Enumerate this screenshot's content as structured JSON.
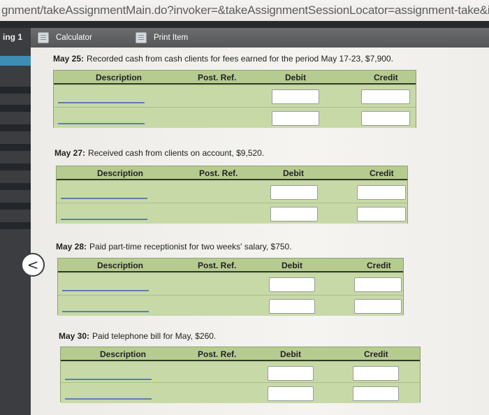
{
  "browser": {
    "url": "gnment/takeAssignmentMain.do?invoker=&takeAssignmentSessionLocator=assignment-take&inprogress"
  },
  "sidebar": {
    "tab_label": "ing 1"
  },
  "toolbar": {
    "calculator_label": "Calculator",
    "print_label": "Print Item"
  },
  "columns": {
    "description": "Description",
    "post_ref": "Post. Ref.",
    "debit": "Debit",
    "credit": "Credit"
  },
  "nav": {
    "back_symbol": "<"
  },
  "transactions": [
    {
      "date": "May 25:",
      "text": "Recorded cash from cash clients for fees earned for the period May 17-23, $7,900."
    },
    {
      "date": "May 27:",
      "text": "Received cash from clients on account, $9,520."
    },
    {
      "date": "May 28:",
      "text": "Paid part-time receptionist for two weeks' salary, $750."
    },
    {
      "date": "May 30:",
      "text": "Paid telephone bill for May, $260."
    }
  ]
}
